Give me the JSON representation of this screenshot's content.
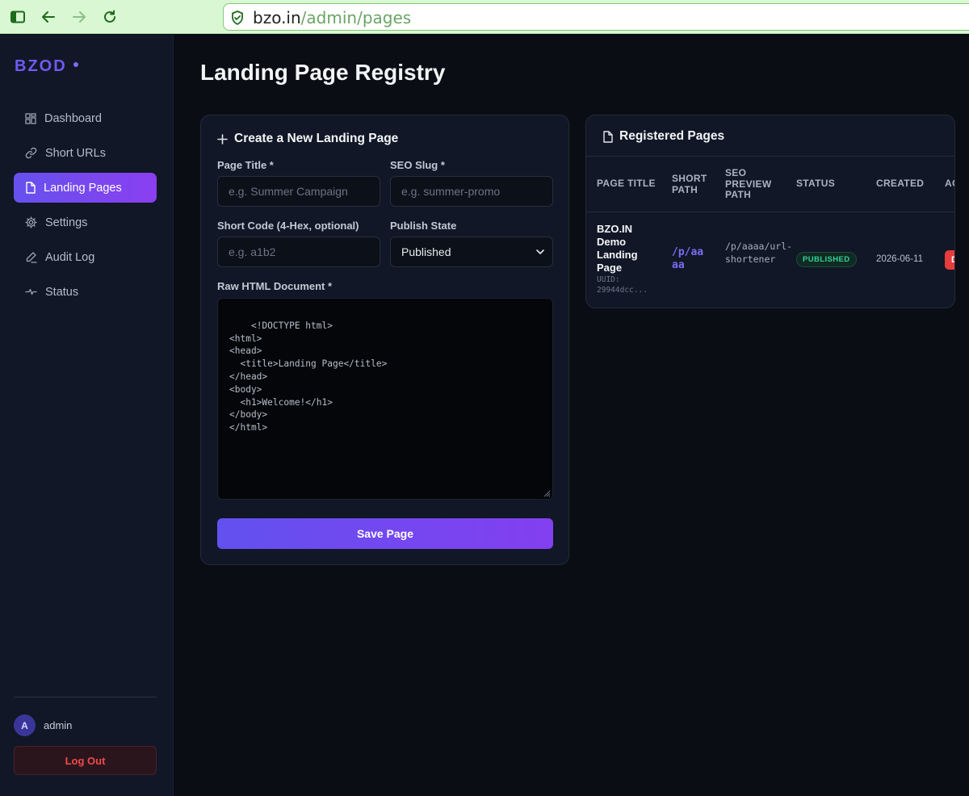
{
  "browser": {
    "url_host": "bzo.in",
    "url_path": "/admin/pages"
  },
  "sidebar": {
    "brand": "BZOD",
    "items": [
      {
        "label": "Dashboard",
        "icon": "grid-icon",
        "active": false
      },
      {
        "label": "Short URLs",
        "icon": "link-icon",
        "active": false
      },
      {
        "label": "Landing Pages",
        "icon": "file-icon",
        "active": true
      },
      {
        "label": "Settings",
        "icon": "gear-icon",
        "active": false
      },
      {
        "label": "Audit Log",
        "icon": "pen-icon",
        "active": false
      },
      {
        "label": "Status",
        "icon": "pulse-icon",
        "active": false
      }
    ],
    "user": {
      "initial": "A",
      "name": "admin"
    },
    "logout_label": "Log Out"
  },
  "main": {
    "title": "Landing Page Registry",
    "form": {
      "heading": "Create a New Landing Page",
      "page_title_label": "Page Title *",
      "page_title_placeholder": "e.g. Summer Campaign",
      "seo_slug_label": "SEO Slug *",
      "seo_slug_placeholder": "e.g. summer-promo",
      "short_code_label": "Short Code (4-Hex, optional)",
      "short_code_placeholder": "e.g. a1b2",
      "publish_state_label": "Publish State",
      "publish_state_value": "Published",
      "html_label": "Raw HTML Document *",
      "html_value": "<!DOCTYPE html>\n<html>\n<head>\n  <title>Landing Page</title>\n</head>\n<body>\n  <h1>Welcome!</h1>\n</body>\n</html>",
      "save_label": "Save Page"
    },
    "registered": {
      "heading": "Registered Pages",
      "columns": [
        "PAGE TITLE",
        "SHORT PATH",
        "SEO PREVIEW PATH",
        "STATUS",
        "CREATED",
        "ACTIONS"
      ],
      "rows": [
        {
          "title": "BZO.IN Demo Landing Page",
          "uuid": "UUID: 29944dcc...",
          "short_path": "/p/aaaa",
          "seo_path": "/p/aaaa/url-shortener",
          "status": "PUBLISHED",
          "created": "2026-06-11",
          "action": "Delete"
        }
      ]
    }
  },
  "colors": {
    "accent": "#6d5bf2",
    "accent_gradient_end": "#8a3ff0",
    "status_published": "#34d399",
    "danger": "#ef4444"
  }
}
